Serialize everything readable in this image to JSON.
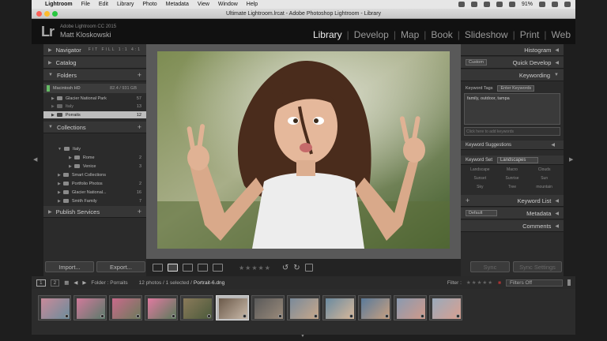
{
  "menubar": {
    "items": [
      "Lightroom",
      "File",
      "Edit",
      "Library",
      "Photo",
      "Metadata",
      "View",
      "Window",
      "Help"
    ],
    "battery": "91%"
  },
  "window": {
    "title": "Ultimate Lightroom.lrcat - Adobe Photoshop Lightroom - Library"
  },
  "identity": {
    "logo": "Lr",
    "version": "Adobe Lightroom CC 2015",
    "owner": "Matt Kloskowski"
  },
  "modules": [
    "Library",
    "Develop",
    "Map",
    "Book",
    "Slideshow",
    "Print",
    "Web"
  ],
  "left": {
    "navigator": {
      "label": "Navigator",
      "zoom": "FIT  FILL  1:1  4:1"
    },
    "catalog": "Catalog",
    "folders": {
      "label": "Folders",
      "volume": "Macintosh HD",
      "volume_info": "82.4 / 931 GB",
      "items": [
        {
          "name": "Glacier National Park",
          "count": "57"
        },
        {
          "name": "Italy",
          "count": "13"
        },
        {
          "name": "Porraits",
          "count": "12"
        }
      ]
    },
    "collections": {
      "label": "Collections",
      "items": [
        {
          "name": "Italy",
          "count": ""
        },
        {
          "name": "Rome",
          "count": "2"
        },
        {
          "name": "Venice",
          "count": "3"
        },
        {
          "name": "Smart Collections",
          "count": ""
        },
        {
          "name": "Portfolio Photos",
          "count": "2"
        },
        {
          "name": "Glacier National...",
          "count": "16"
        },
        {
          "name": "Smith Family",
          "count": "7"
        }
      ]
    },
    "publish": "Publish Services",
    "import": "Import...",
    "export": "Export..."
  },
  "right": {
    "histogram": "Histogram",
    "quick_develop": "Quick Develop",
    "preset": "Custom",
    "keywording": "Keywording",
    "keyword_tags": "Keyword Tags",
    "tag_mode": "Enter Keywords",
    "tags": "family, outdoor, tampa",
    "add_placeholder": "Click here to add keywords",
    "suggestions": "Keyword Suggestions",
    "keyword_set": "Keyword Set",
    "set_value": "Landscapes",
    "set_keywords": [
      "Landscape",
      "Macro",
      "Clouds",
      "Sunset",
      "Sunrise",
      "Sun",
      "Sky",
      "Tree",
      "mountain"
    ],
    "keyword_list": "Keyword List",
    "metadata": "Metadata",
    "metadata_preset": "Default",
    "comments": "Comments",
    "sync": "Sync",
    "sync_settings": "Sync Settings"
  },
  "filmstrip": {
    "page1": "1",
    "page2": "2",
    "folder": "Folder : Porraits",
    "count": "12 photos / 1 selected /",
    "file": "Portrait-6.dng",
    "filter": "Filter :",
    "filters_off": "Filters Off"
  },
  "colors": {
    "accent": "#e8e8e8",
    "panel": "#2b2b2b"
  }
}
